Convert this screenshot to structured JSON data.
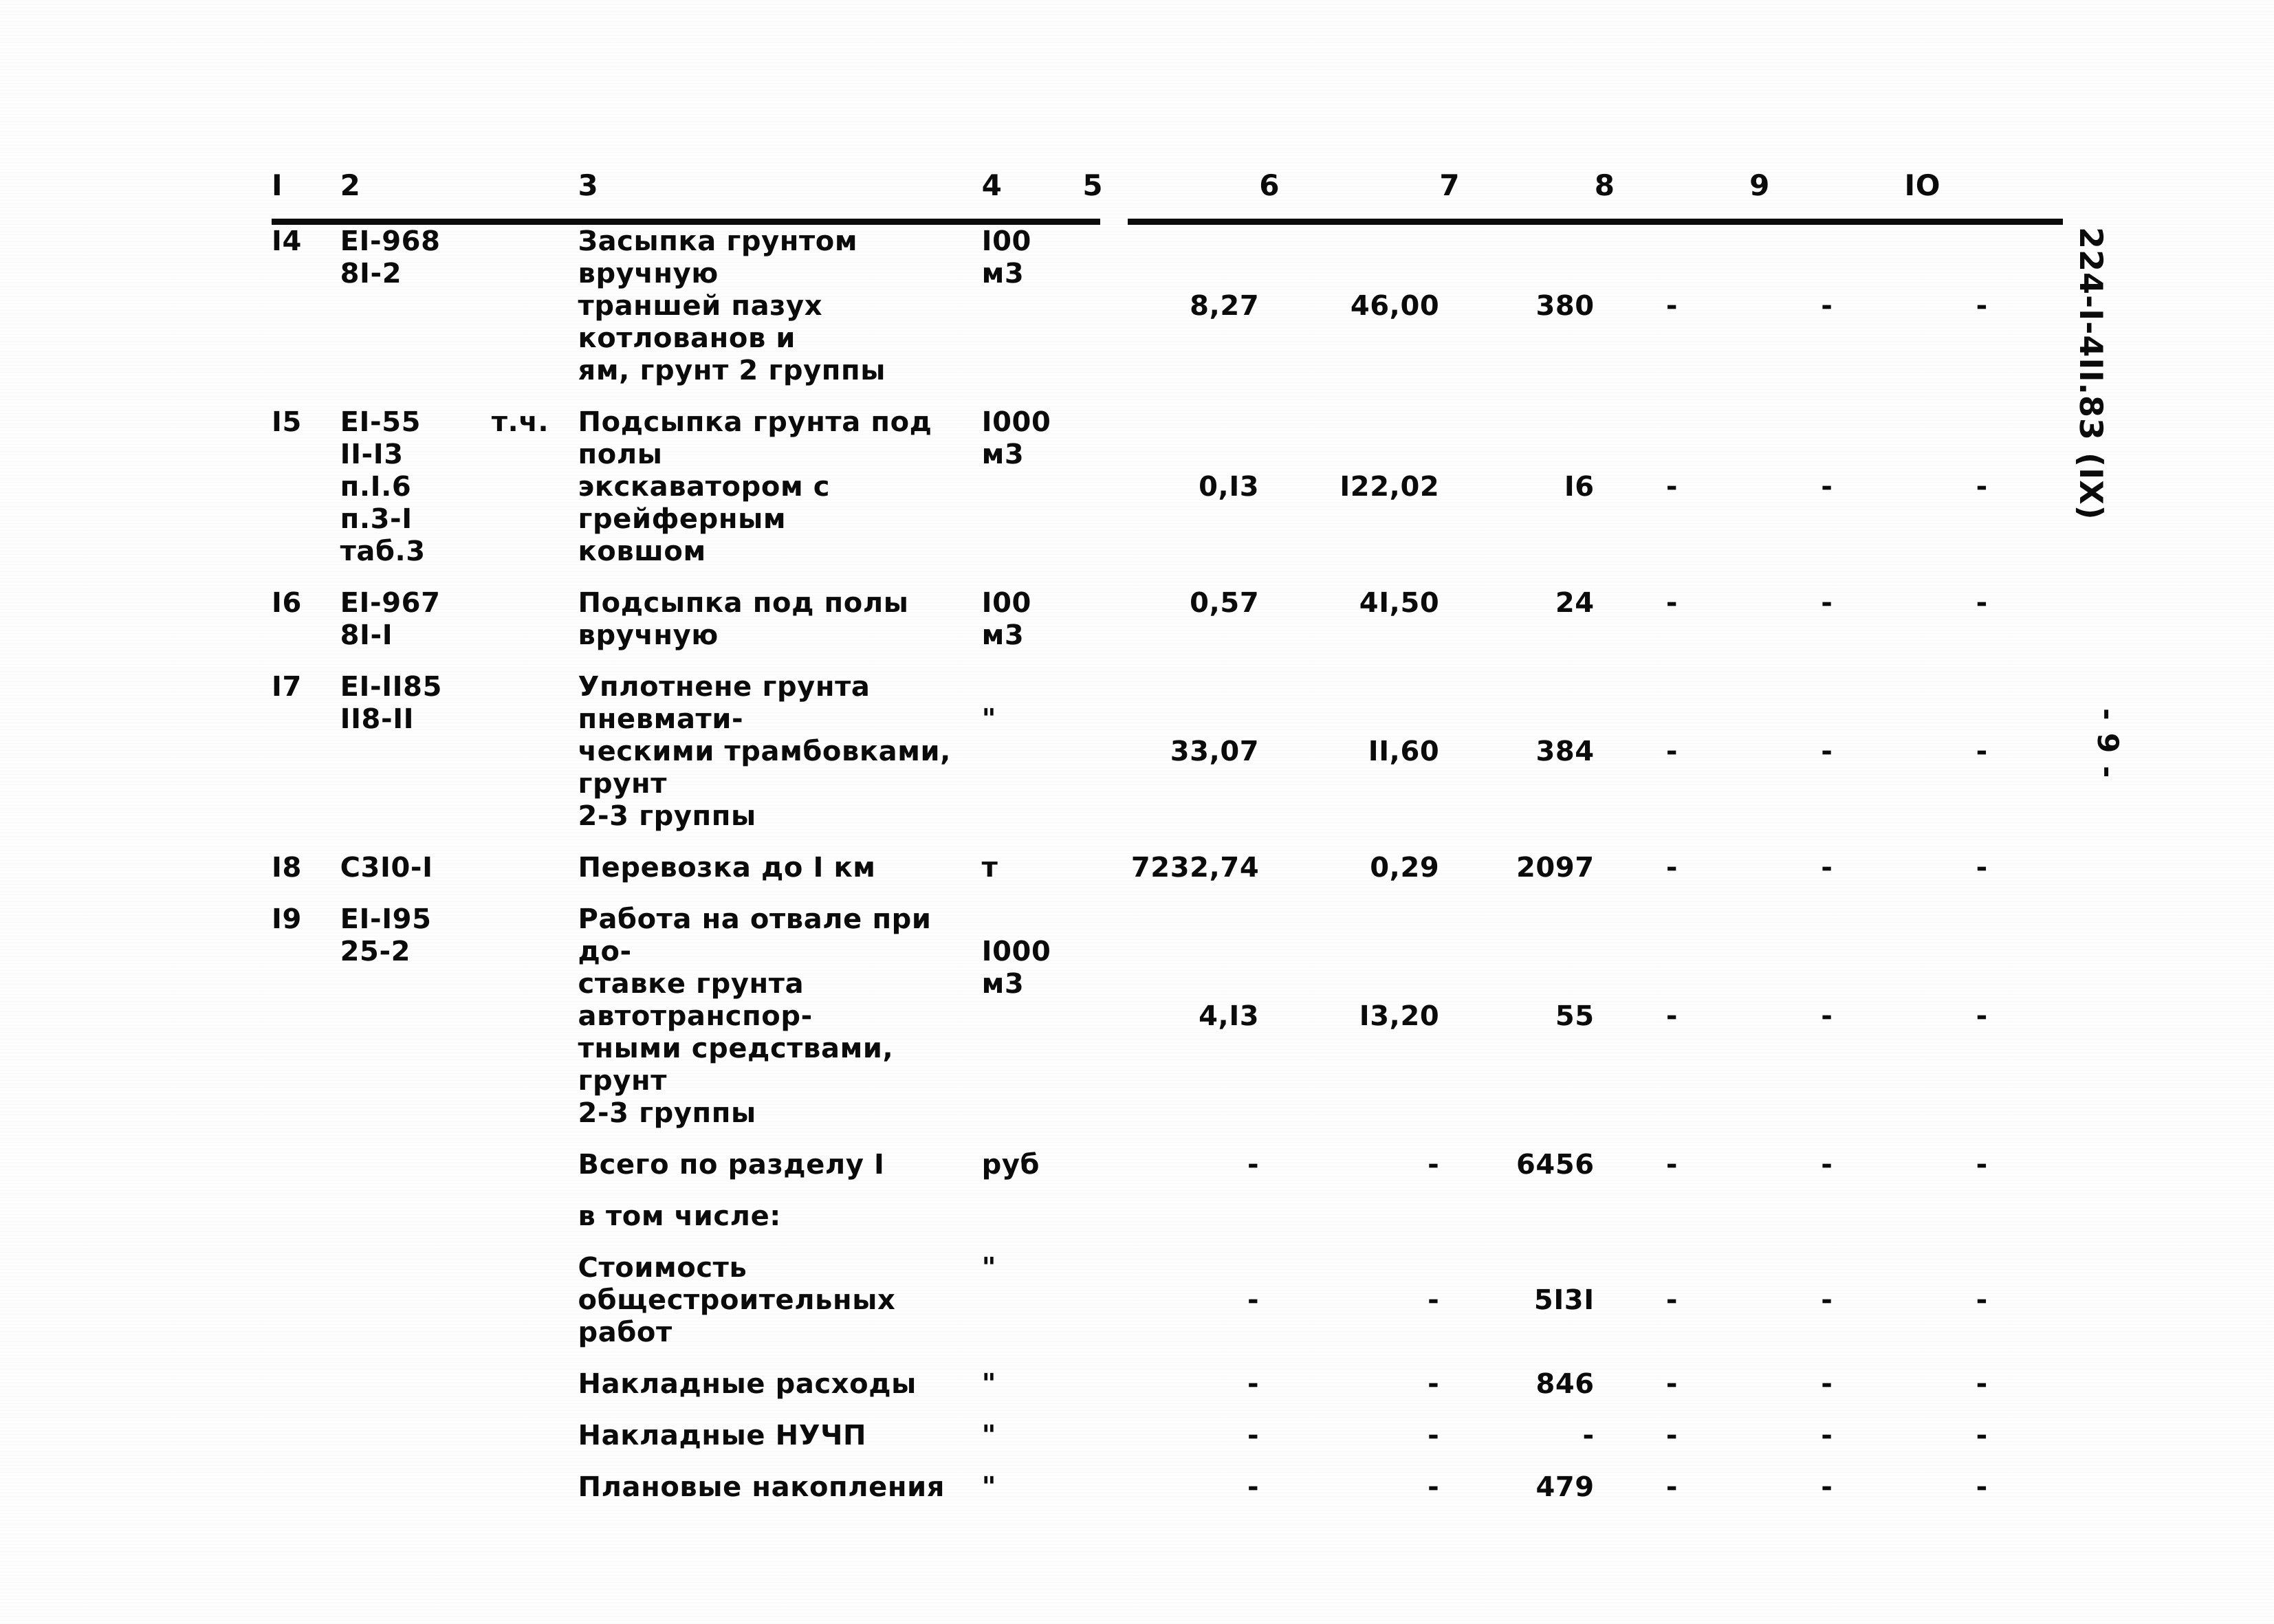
{
  "document": {
    "code_stamp": "224-I-4II.83 (IX)",
    "page_number": "- 9 -"
  },
  "table": {
    "column_headers": [
      "I",
      "2",
      "3",
      "4",
      "5",
      "6",
      "7",
      "8",
      "9",
      "IO"
    ],
    "rows": [
      {
        "num": "I4",
        "code": "EI-968\n8I-2",
        "note": "",
        "desc": "Засыпка грунтом вручную\nтраншей пазух котлованов и\nям, грунт 2 группы",
        "unit": "I00\nм3",
        "c5": "8,27",
        "c6": "46,00",
        "c7": "380",
        "c8": "-",
        "c9": "-",
        "c10": "-"
      },
      {
        "num": "I5",
        "code": "EI-55\nII-I3\nп.I.6\nп.3-I\nтаб.3",
        "note": "т.ч.",
        "desc": "Подсыпка грунта под полы\nэкскаватором с грейферным\nковшом",
        "unit": "I000\nм3",
        "c5": "0,I3",
        "c6": "I22,02",
        "c7": "I6",
        "c8": "-",
        "c9": "-",
        "c10": "-"
      },
      {
        "num": "I6",
        "code": "EI-967\n8I-I",
        "note": "",
        "desc": "Подсыпка под полы вручную",
        "unit": "I00\nм3",
        "c5": "0,57",
        "c6": "4I,50",
        "c7": "24",
        "c8": "-",
        "c9": "-",
        "c10": "-"
      },
      {
        "num": "I7",
        "code": "EI-II85\nII8-II",
        "note": "",
        "desc": "Уплотнене грунта пневмати-\nческими трамбовками, грунт\n2-3 группы",
        "unit": "\"",
        "c5": "33,07",
        "c6": "II,60",
        "c7": "384",
        "c8": "-",
        "c9": "-",
        "c10": "-"
      },
      {
        "num": "I8",
        "code": "C3I0-I",
        "note": "",
        "desc": "Перевозка до I км",
        "unit": "т",
        "c5": "7232,74",
        "c6": "0,29",
        "c7": "2097",
        "c8": "-",
        "c9": "-",
        "c10": "-"
      },
      {
        "num": "I9",
        "code": "EI-I95\n25-2",
        "note": "",
        "desc": "Работа на отвале при до-\nставке грунта автотранспор-\nтными средствами, грунт\n2-3 группы",
        "unit": "I000\nм3",
        "c5": "4,I3",
        "c6": "I3,20",
        "c7": "55",
        "c8": "-",
        "c9": "-",
        "c10": "-"
      },
      {
        "num": "",
        "code": "",
        "note": "",
        "desc": "Всего по разделу I",
        "unit": "руб",
        "c5": "-",
        "c6": "-",
        "c7": "6456",
        "c8": "-",
        "c9": "-",
        "c10": "-"
      },
      {
        "num": "",
        "code": "",
        "note": "",
        "desc": "в том числе:",
        "unit": "",
        "c5": "",
        "c6": "",
        "c7": "",
        "c8": "",
        "c9": "",
        "c10": ""
      },
      {
        "num": "",
        "code": "",
        "note": "",
        "desc": "Стоимость общестроительных\nработ",
        "unit": "\"",
        "c5": "-",
        "c6": "-",
        "c7": "5I3I",
        "c8": "-",
        "c9": "-",
        "c10": "-"
      },
      {
        "num": "",
        "code": "",
        "note": "",
        "desc": "Накладные расходы",
        "unit": "\"",
        "c5": "-",
        "c6": "-",
        "c7": "846",
        "c8": "-",
        "c9": "-",
        "c10": "-"
      },
      {
        "num": "",
        "code": "",
        "note": "",
        "desc": "Накладные НУЧП",
        "unit": "\"",
        "c5": "-",
        "c6": "-",
        "c7": "-",
        "c8": "-",
        "c9": "-",
        "c10": "-"
      },
      {
        "num": "",
        "code": "",
        "note": "",
        "desc": "Плановые накопления",
        "unit": "\"",
        "c5": "-",
        "c6": "-",
        "c7": "479",
        "c8": "-",
        "c9": "-",
        "c10": "-"
      }
    ]
  }
}
